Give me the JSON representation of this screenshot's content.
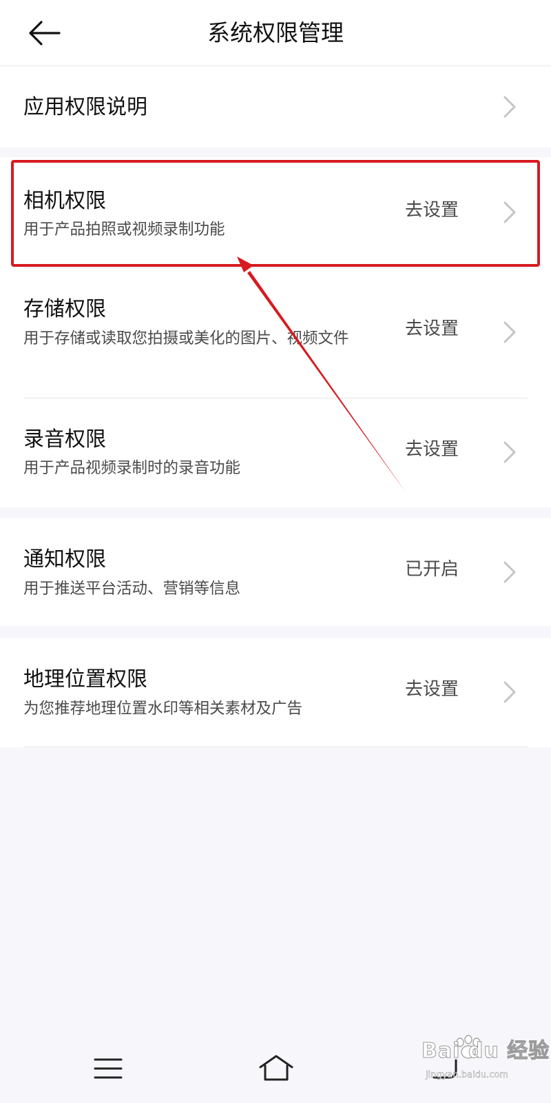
{
  "header": {
    "title": "系统权限管理",
    "back_icon": "arrow-left-icon"
  },
  "sections": [
    {
      "rows": [
        {
          "title": "应用权限说明",
          "desc": "",
          "status": "",
          "icon": "chevron-right-icon"
        }
      ]
    },
    {
      "rows": [
        {
          "title": "相机权限",
          "desc": "用于产品拍照或视频录制功能",
          "status": "去设置",
          "icon": "chevron-right-icon"
        },
        {
          "title": "存储权限",
          "desc": "用于存储或读取您拍摄或美化的图片、视频文件",
          "status": "去设置",
          "icon": "chevron-right-icon"
        },
        {
          "title": "录音权限",
          "desc": "用于产品视频录制时的录音功能",
          "status": "去设置",
          "icon": "chevron-right-icon"
        }
      ]
    },
    {
      "rows": [
        {
          "title": "通知权限",
          "desc": "用于推送平台活动、营销等信息",
          "status": "已开启",
          "icon": "chevron-right-icon"
        }
      ]
    },
    {
      "rows": [
        {
          "title": "地理位置权限",
          "desc": "为您推荐地理位置水印等相关素材及广告",
          "status": "去设置",
          "icon": "chevron-right-icon"
        }
      ]
    }
  ],
  "annotation": {
    "color": "#d71a1f",
    "target": "相机权限"
  },
  "nav_bar": {
    "icons": [
      "menu-icon",
      "home-icon",
      "back-icon"
    ]
  },
  "watermark": {
    "text": "Bai du 经验",
    "sub": "jingyan.baidu.com"
  },
  "colors": {
    "background": "#f7f7fb",
    "surface": "#ffffff",
    "divider": "#e5e5ea",
    "secondary_text": "#4a4a4a",
    "chevron": "#c4c4c8"
  }
}
